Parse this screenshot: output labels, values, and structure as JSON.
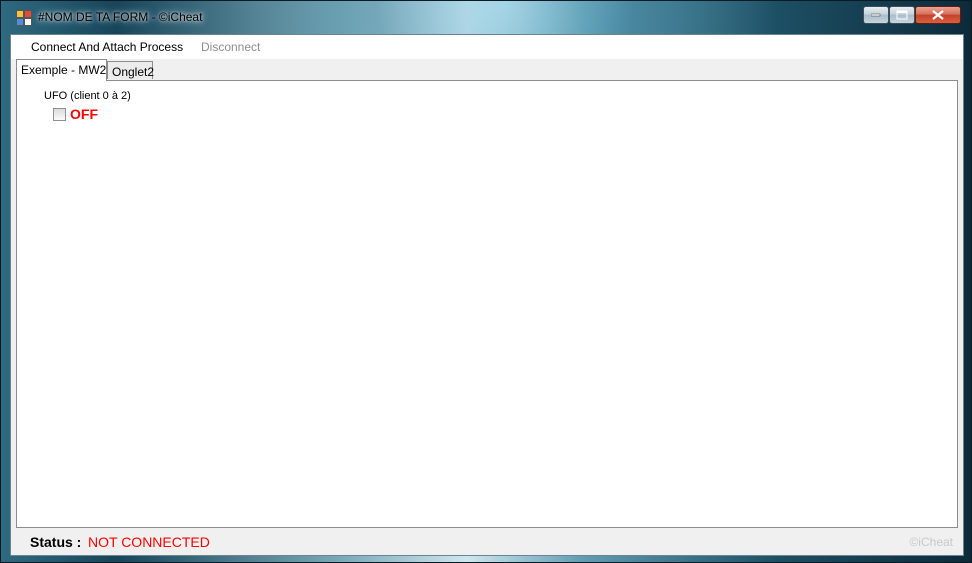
{
  "window": {
    "title": "#NOM DE TA FORM - ©iCheat",
    "icon": "app-form-icon",
    "controls": [
      "minimize-icon",
      "maximize-icon",
      "close-icon"
    ]
  },
  "menu": {
    "connect": "Connect And Attach Process",
    "disconnect": "Disconnect"
  },
  "tabs": [
    {
      "label": "Exemple - MW2",
      "active": true
    },
    {
      "label": "Onglet2",
      "active": false
    }
  ],
  "panel": {
    "group_label": "UFO (client 0 à 2)",
    "checkbox_checked": false,
    "toggle_state": "OFF"
  },
  "status": {
    "label": "Status :",
    "value": "NOT CONNECTED",
    "watermark": "©iCheat"
  },
  "colors": {
    "off": "#ff0000",
    "status_value": "#ff0000"
  }
}
